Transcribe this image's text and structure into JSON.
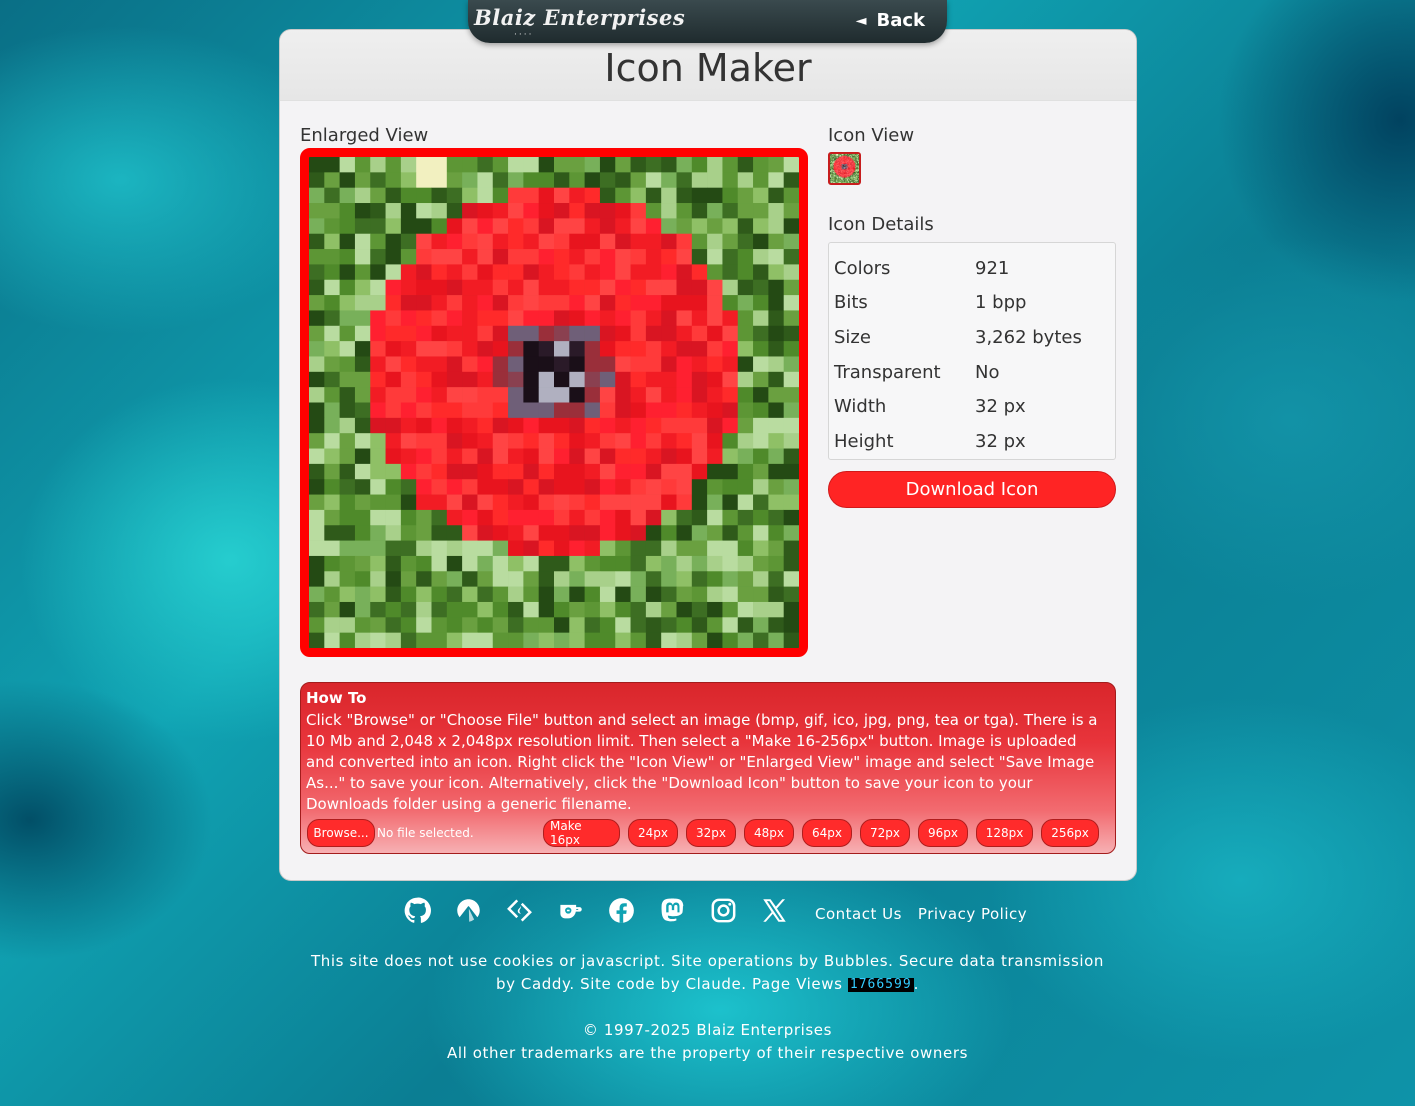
{
  "topbar": {
    "brand": "Blaiz Enterprises",
    "brand_dots": "····",
    "back_label": "Back",
    "back_arrow": "◄"
  },
  "page_title": "Icon Maker",
  "enlarged_view_label": "Enlarged View",
  "icon_view_label": "Icon View",
  "icon_details_label": "Icon Details",
  "details": [
    {
      "key": "Colors",
      "value": "921"
    },
    {
      "key": "Bits",
      "value": "1 bpp"
    },
    {
      "key": "Size",
      "value": "3,262 bytes"
    },
    {
      "key": "Transparent",
      "value": "No"
    },
    {
      "key": "Width",
      "value": "32 px"
    },
    {
      "key": "Height",
      "value": "32 px"
    }
  ],
  "download_label": "Download Icon",
  "howto": {
    "title": "How To",
    "text": "Click \"Browse\" or \"Choose File\" button and select an image (bmp, gif, ico, jpg, png, tea or tga). There is a 10 Mb and 2,048 x 2,048px resolution limit. Then select a \"Make 16-256px\" button. Image is uploaded and converted into an icon. Right click the \"Icon View\" or \"Enlarged View\" image and select \"Save Image As...\" to save your icon. Alternatively, click the \"Download Icon\" button to save your icon to your Downloads folder using a generic filename.",
    "browse_label": "Browse...",
    "no_file": "No file selected.",
    "make_buttons": [
      "Make 16px",
      "24px",
      "32px",
      "48px",
      "64px",
      "72px",
      "96px",
      "128px",
      "256px"
    ]
  },
  "footer": {
    "icons": [
      "github-icon",
      "codeberg-icon",
      "sourceforge-icon",
      "gitea-icon",
      "facebook-icon",
      "mastodon-icon",
      "instagram-icon",
      "x-icon"
    ],
    "links": [
      "Contact Us",
      "Privacy Policy"
    ],
    "text_before_counter": "This site does not use cookies or javascript. Site operations by Bubbles. Secure data transmission by Caddy. Site code by Claude. Page Views ",
    "page_views": "1766599",
    "text_after_counter": ".",
    "copyright": "© 1997-2025 Blaiz Enterprises",
    "trademarks": "All other trademarks are the property of their respective owners"
  },
  "colors": {
    "accent_red": "#ff2424",
    "panel_bg": "#f4f3f5",
    "teal_bg": "#10a3b3"
  }
}
